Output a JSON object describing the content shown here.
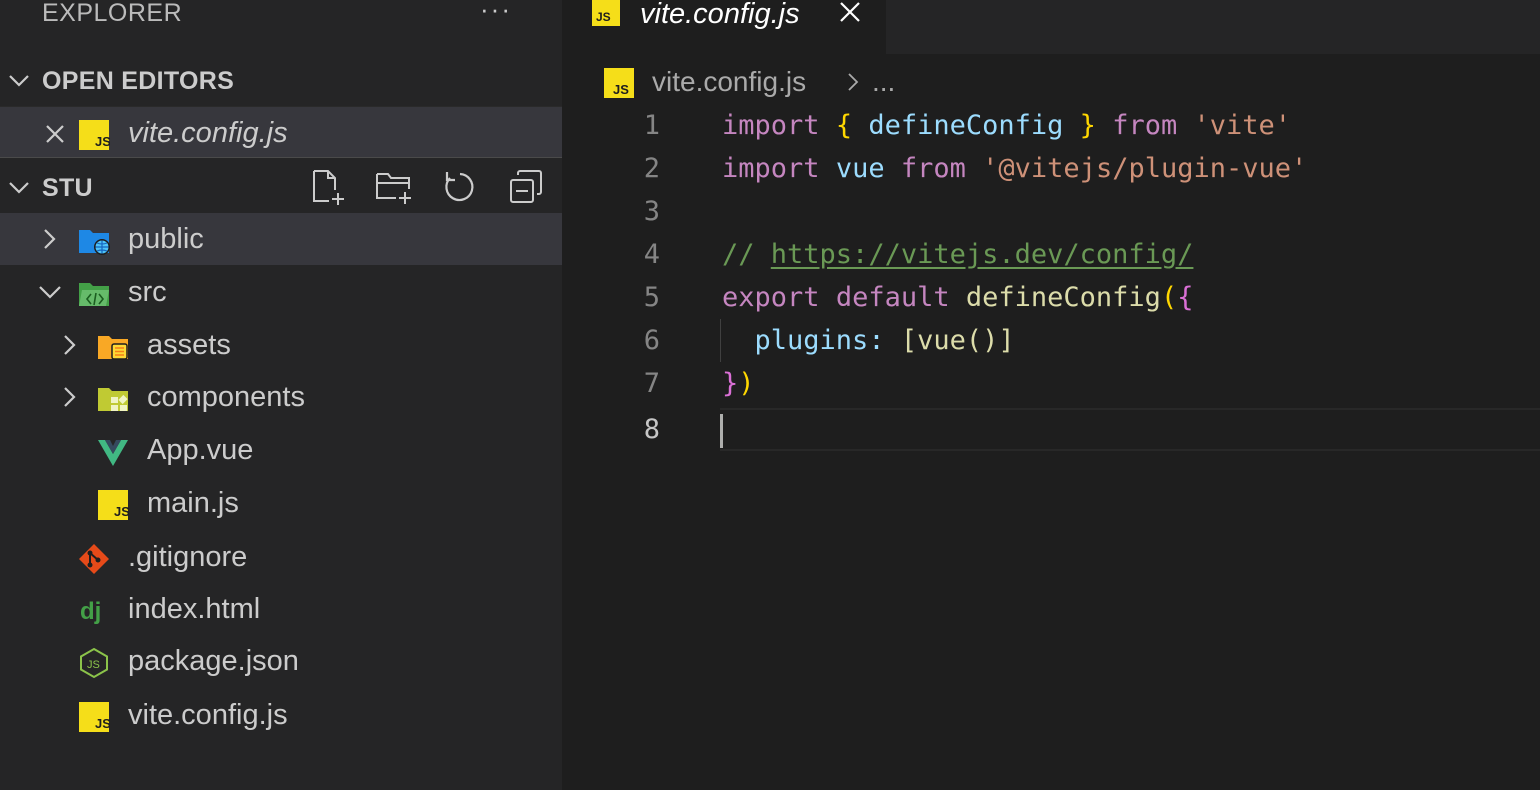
{
  "sidebar": {
    "title": "EXPLORER",
    "more_actions": "···",
    "open_editors": {
      "label": "OPEN EDITORS",
      "items": [
        {
          "label": "vite.config.js",
          "icon": "js-file-icon"
        }
      ]
    },
    "workspace": {
      "label": "STU",
      "actions": [
        "new-file-icon",
        "new-folder-icon",
        "refresh-icon",
        "collapse-all-icon"
      ],
      "tree": [
        {
          "label": "public",
          "type": "folder",
          "expanded": false,
          "icon": "folder-public-icon"
        },
        {
          "label": "src",
          "type": "folder",
          "expanded": true,
          "icon": "folder-src-icon"
        },
        {
          "label": "assets",
          "type": "folder",
          "expanded": false,
          "icon": "folder-assets-icon"
        },
        {
          "label": "components",
          "type": "folder",
          "expanded": false,
          "icon": "folder-components-icon"
        },
        {
          "label": "App.vue",
          "type": "file",
          "icon": "vue-file-icon"
        },
        {
          "label": "main.js",
          "type": "file",
          "icon": "js-file-icon"
        },
        {
          "label": ".gitignore",
          "type": "file",
          "icon": "git-file-icon"
        },
        {
          "label": "index.html",
          "type": "file",
          "icon": "django-file-icon"
        },
        {
          "label": "package.json",
          "type": "file",
          "icon": "nodejs-file-icon"
        },
        {
          "label": "vite.config.js",
          "type": "file",
          "icon": "js-file-icon"
        }
      ]
    }
  },
  "editor": {
    "tab": {
      "label": "vite.config.js",
      "icon": "js-file-icon"
    },
    "breadcrumb": {
      "file": "vite.config.js",
      "more": "..."
    },
    "line_numbers": [
      "1",
      "2",
      "3",
      "4",
      "5",
      "6",
      "7",
      "8"
    ],
    "current_line": 8,
    "code": {
      "l1": {
        "t1": "import",
        "t2": " ",
        "t3": "{",
        "t4": " defineConfig ",
        "t5": "}",
        "t6": " ",
        "t7": "from",
        "t8": " ",
        "t9": "'vite'"
      },
      "l2": {
        "t1": "import",
        "t2": " ",
        "t3": "vue",
        "t4": " ",
        "t5": "from",
        "t6": " ",
        "t7": "'@vitejs/plugin-vue'"
      },
      "l3": "",
      "l4": {
        "t1": "// ",
        "t2": "https://vitejs.dev/config/"
      },
      "l5": {
        "t1": "export",
        "t2": " ",
        "t3": "default",
        "t4": " ",
        "t5": "defineConfig",
        "t6": "(",
        "t7": "{"
      },
      "l6": {
        "t1": "  ",
        "t2": "plugins",
        "t3": ":",
        "t4": " ",
        "t5": "[",
        "t6": "vue",
        "t7": "()",
        "t8": "]"
      },
      "l7": {
        "t1": "}",
        "t2": ")"
      },
      "l8": ""
    }
  },
  "colors": {
    "js_icon": "#f5de19",
    "folder": "#f0b429",
    "keyword": "#c586c0",
    "variable": "#9cdcfe",
    "function": "#dcdcaa",
    "string": "#ce9178",
    "comment": "#6a9955"
  }
}
